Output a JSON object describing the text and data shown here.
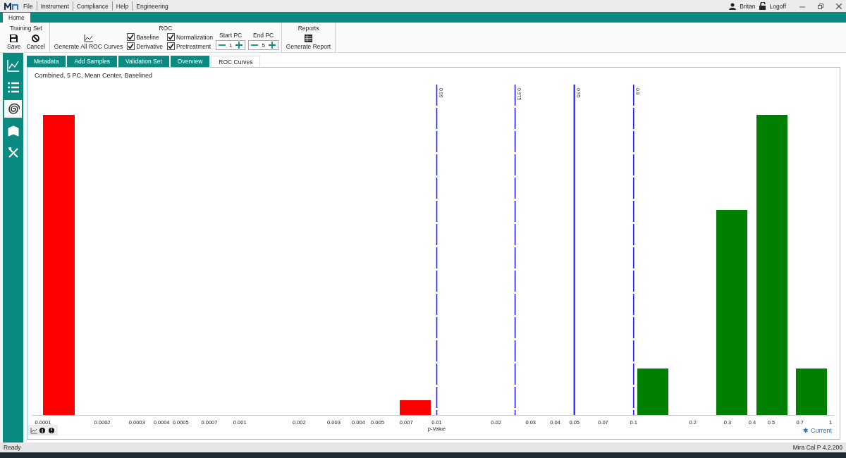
{
  "menu_bar": {
    "items": [
      "File",
      "Instrument",
      "Compliance",
      "Help",
      "Engineering"
    ],
    "user": "Britan",
    "logoff": "Logoff"
  },
  "ribbon_tabs": [
    {
      "label": "Home",
      "selected": true
    }
  ],
  "ribbon": {
    "training_set": {
      "title": "Training Set",
      "buttons": [
        {
          "label": "Save",
          "kind": "save"
        },
        {
          "label": "Cancel",
          "kind": "cancel"
        }
      ]
    },
    "roc": {
      "title": "ROC",
      "generate_button": "Generate All ROC Curves",
      "checkboxes": [
        {
          "label": "Baseline",
          "checked": true
        },
        {
          "label": "Derivative",
          "checked": true
        },
        {
          "label": "Normalization",
          "checked": true
        },
        {
          "label": "Pretreatment",
          "checked": true
        }
      ],
      "start_pc": {
        "label": "Start PC",
        "value": "1"
      },
      "end_pc": {
        "label": "End PC",
        "value": "5"
      }
    },
    "reports": {
      "title": "Reports",
      "button": "Generate Report"
    }
  },
  "sidebar": [
    {
      "kind": "chart",
      "selected": false
    },
    {
      "kind": "list",
      "selected": false
    },
    {
      "kind": "spiral",
      "selected": true
    },
    {
      "kind": "book",
      "selected": false
    },
    {
      "kind": "tools",
      "selected": false
    }
  ],
  "content_tabs": [
    {
      "label": "Metadata",
      "selected": false
    },
    {
      "label": "Add Samples",
      "selected": false
    },
    {
      "label": "Validation Set",
      "selected": false
    },
    {
      "label": "Overview",
      "selected": false
    },
    {
      "label": "ROC Curves",
      "selected": true
    }
  ],
  "chart": {
    "title": "Combined, 5 PC, Mean Center, Baselined",
    "x_ticks": [
      "0.0001",
      "0.0002",
      "0.0003",
      "0.0004",
      "0.0005",
      "0.0007",
      "0.001",
      "0.002",
      "0.003",
      "0.004",
      "0.005",
      "0.007",
      "0.01",
      "0.02",
      "0.03",
      "0.04",
      "0.05",
      "0.07",
      "0.1",
      "0.2",
      "0.3",
      "0.4",
      "0.5",
      "0.7",
      "1"
    ],
    "x_label": "p-Value",
    "thresholds": [
      {
        "label": "0.99",
        "kind": "dashed"
      },
      {
        "label": "0.975",
        "kind": "dashed"
      },
      {
        "label": "0.95",
        "kind": "solid"
      },
      {
        "label": "0.9",
        "kind": "dashed"
      }
    ],
    "legend": {
      "symbol": "✱",
      "label": "Current"
    }
  },
  "status_bar": {
    "left": "Ready",
    "right": "Mira Cal P 4.2.200"
  }
}
